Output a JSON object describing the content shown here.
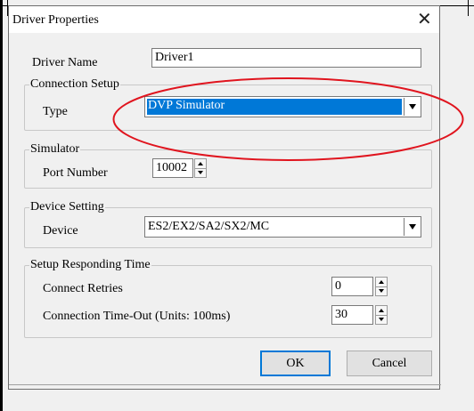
{
  "dialog": {
    "title": "Driver Properties",
    "driver_name_label": "Driver Name",
    "driver_name_value": "Driver1",
    "connection_setup": {
      "legend": "Connection Setup",
      "type_label": "Type",
      "type_value": "DVP Simulator"
    },
    "simulator": {
      "legend": "Simulator",
      "port_label": "Port Number",
      "port_value": "10002"
    },
    "device_setting": {
      "legend": "Device Setting",
      "device_label": "Device",
      "device_value": "ES2/EX2/SA2/SX2/MC"
    },
    "responding_time": {
      "legend": "Setup Responding Time",
      "retries_label": "Connect Retries",
      "retries_value": "0",
      "timeout_label": "Connection Time-Out (Units: 100ms)",
      "timeout_value": "30"
    },
    "ok_label": "OK",
    "cancel_label": "Cancel"
  },
  "colors": {
    "selection": "#0078d7",
    "annotation": "#e0141e"
  },
  "icons": {
    "close": "close-icon",
    "dropdown": "chevron-down-icon",
    "spin": "spin-arrows-icon"
  }
}
